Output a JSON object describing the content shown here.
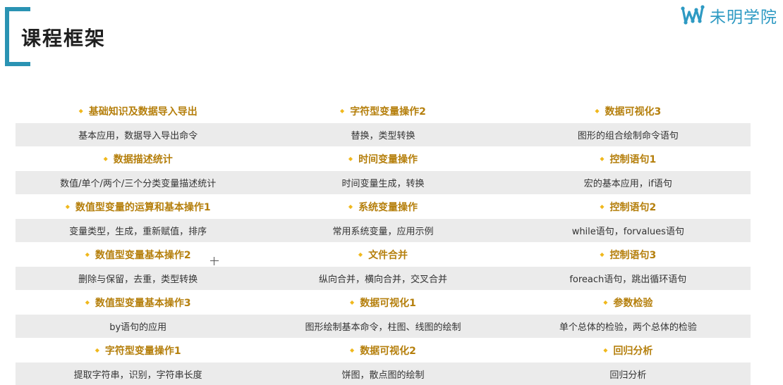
{
  "page_title": "课程框架",
  "logo": {
    "text": "未明学院",
    "icon": "brand-logo-icon",
    "color": "#2e9ac3"
  },
  "accent_color": "#2a93b3",
  "bullet_icon": "diamond-bullet-icon",
  "rows": [
    {
      "titles": [
        "基础知识及数据导入导出",
        "字符型变量操作2",
        "数据可视化3"
      ],
      "descs": [
        "基本应用，数据导入导出命令",
        "替换，类型转换",
        "图形的组合绘制命令语句"
      ]
    },
    {
      "titles": [
        "数据描述统计",
        "时间变量操作",
        "控制语句1"
      ],
      "descs": [
        "数值/单个/两个/三个分类变量描述统计",
        "时间变量生成，转换",
        "宏的基本应用，if语句"
      ]
    },
    {
      "titles": [
        "数值型变量的运算和基本操作1",
        "系统变量操作",
        "控制语句2"
      ],
      "descs": [
        "变量类型，生成，重新赋值，排序",
        "常用系统变量，应用示例",
        "while语句，forvalues语句"
      ]
    },
    {
      "titles": [
        "数值型变量基本操作2",
        "文件合并",
        "控制语句3"
      ],
      "descs": [
        "删除与保留，去重，类型转换",
        "纵向合并，横向合并，交叉合并",
        "foreach语句，跳出循环语句"
      ]
    },
    {
      "titles": [
        "数值型变量基本操作3",
        "数据可视化1",
        "参数检验"
      ],
      "descs": [
        "by语句的应用",
        "图形绘制基本命令，柱图、线图的绘制",
        "单个总体的检验，两个总体的检验"
      ]
    },
    {
      "titles": [
        "字符型变量操作1",
        "数据可视化2",
        "回归分析"
      ],
      "descs": [
        "提取字符串，识别，字符串长度",
        "饼图，散点图的绘制",
        "回归分析"
      ]
    }
  ]
}
